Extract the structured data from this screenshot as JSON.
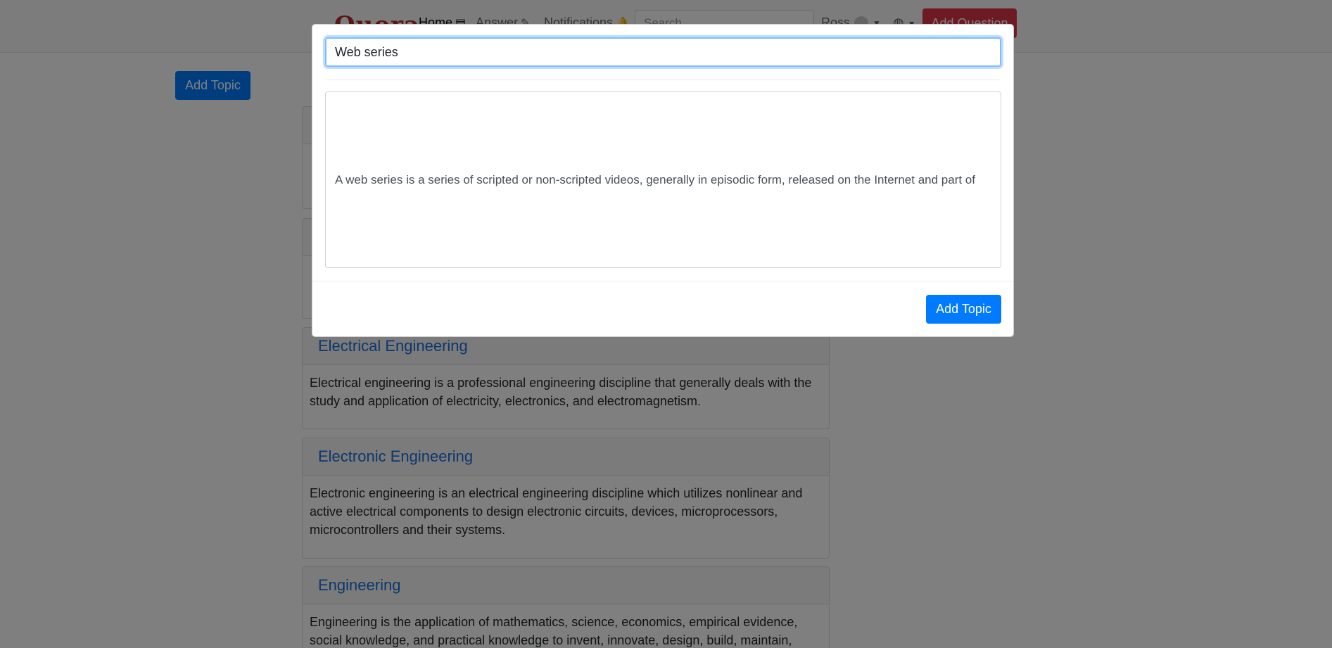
{
  "navbar": {
    "logo": "Quora",
    "home_label": "Home",
    "answer_label": "Answer",
    "notifications_label": "Notifications",
    "search_placeholder": "Search",
    "user_label": "Ross",
    "add_question_label": "Add Question"
  },
  "main": {
    "add_topic_label": "Add Topic",
    "topics": [
      {
        "title": "",
        "description": ""
      },
      {
        "title": "",
        "description": ""
      },
      {
        "title": "Electrical Engineering",
        "description": "Electrical engineering is a professional engineering discipline that generally deals with the study and application of electricity, electronics, and electromagnetism."
      },
      {
        "title": "Electronic Engineering",
        "description": "Electronic engineering is an electrical engineering discipline which utilizes nonlinear and active electrical components to design electronic circuits, devices, microprocessors, microcontrollers and their systems."
      },
      {
        "title": "Engineering",
        "description": "Engineering is the application of mathematics, science, economics, empirical evidence, social knowledge, and practical knowledge to invent, innovate, design, build, maintain, research, and"
      }
    ]
  },
  "modal": {
    "topic_name_value": "Web series",
    "topic_description_value": "A web series is a series of scripted or non-scripted videos, generally in episodic form, released on the Internet and part of",
    "submit_label": "Add Topic"
  },
  "colors": {
    "primary": "#007bff",
    "danger": "#dc3545",
    "link": "#1a6ed8",
    "brand": "#b92b27"
  }
}
